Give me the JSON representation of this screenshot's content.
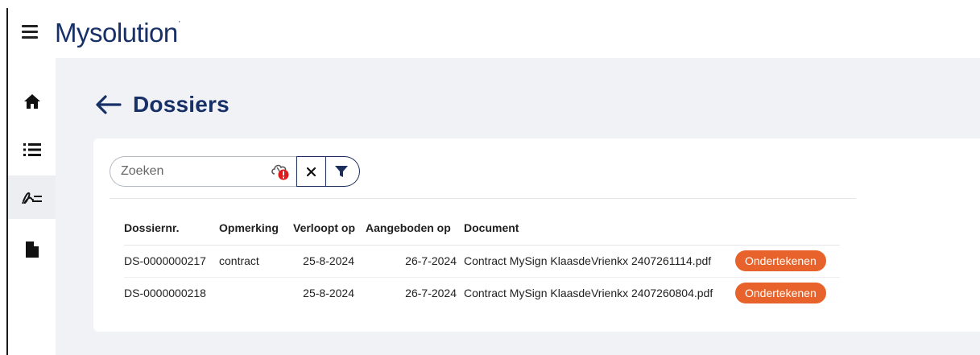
{
  "header": {
    "logo": "Mysolution",
    "logo_mark": "·"
  },
  "sidebar": {
    "items": [
      {
        "icon": "home-icon"
      },
      {
        "icon": "list-icon"
      },
      {
        "icon": "signature-icon",
        "active": true
      },
      {
        "icon": "document-icon"
      }
    ]
  },
  "page": {
    "title": "Dossiers"
  },
  "search": {
    "placeholder": "Zoeken",
    "value": ""
  },
  "table": {
    "headers": {
      "dossiernr": "Dossiernr.",
      "opmerking": "Opmerking",
      "verloopt_op": "Verloopt op",
      "aangeboden_op": "Aangeboden op",
      "document": "Document"
    },
    "rows": [
      {
        "dossiernr": "DS-0000000217",
        "opmerking": "contract",
        "verloopt_op": "25-8-2024",
        "aangeboden_op": "26-7-2024",
        "document": "Contract MySign KlaasdeVrienkx 2407261114.pdf",
        "action": "Ondertekenen"
      },
      {
        "dossiernr": "DS-0000000218",
        "opmerking": "",
        "verloopt_op": "25-8-2024",
        "aangeboden_op": "26-7-2024",
        "document": "Contract MySign KlaasdeVrienkx 2407260804.pdf",
        "action": "Ondertekenen"
      }
    ]
  },
  "colors": {
    "brand": "#173067",
    "accent": "#e8632b",
    "background": "#f1f2f5",
    "active_nav": "#eceef2"
  }
}
